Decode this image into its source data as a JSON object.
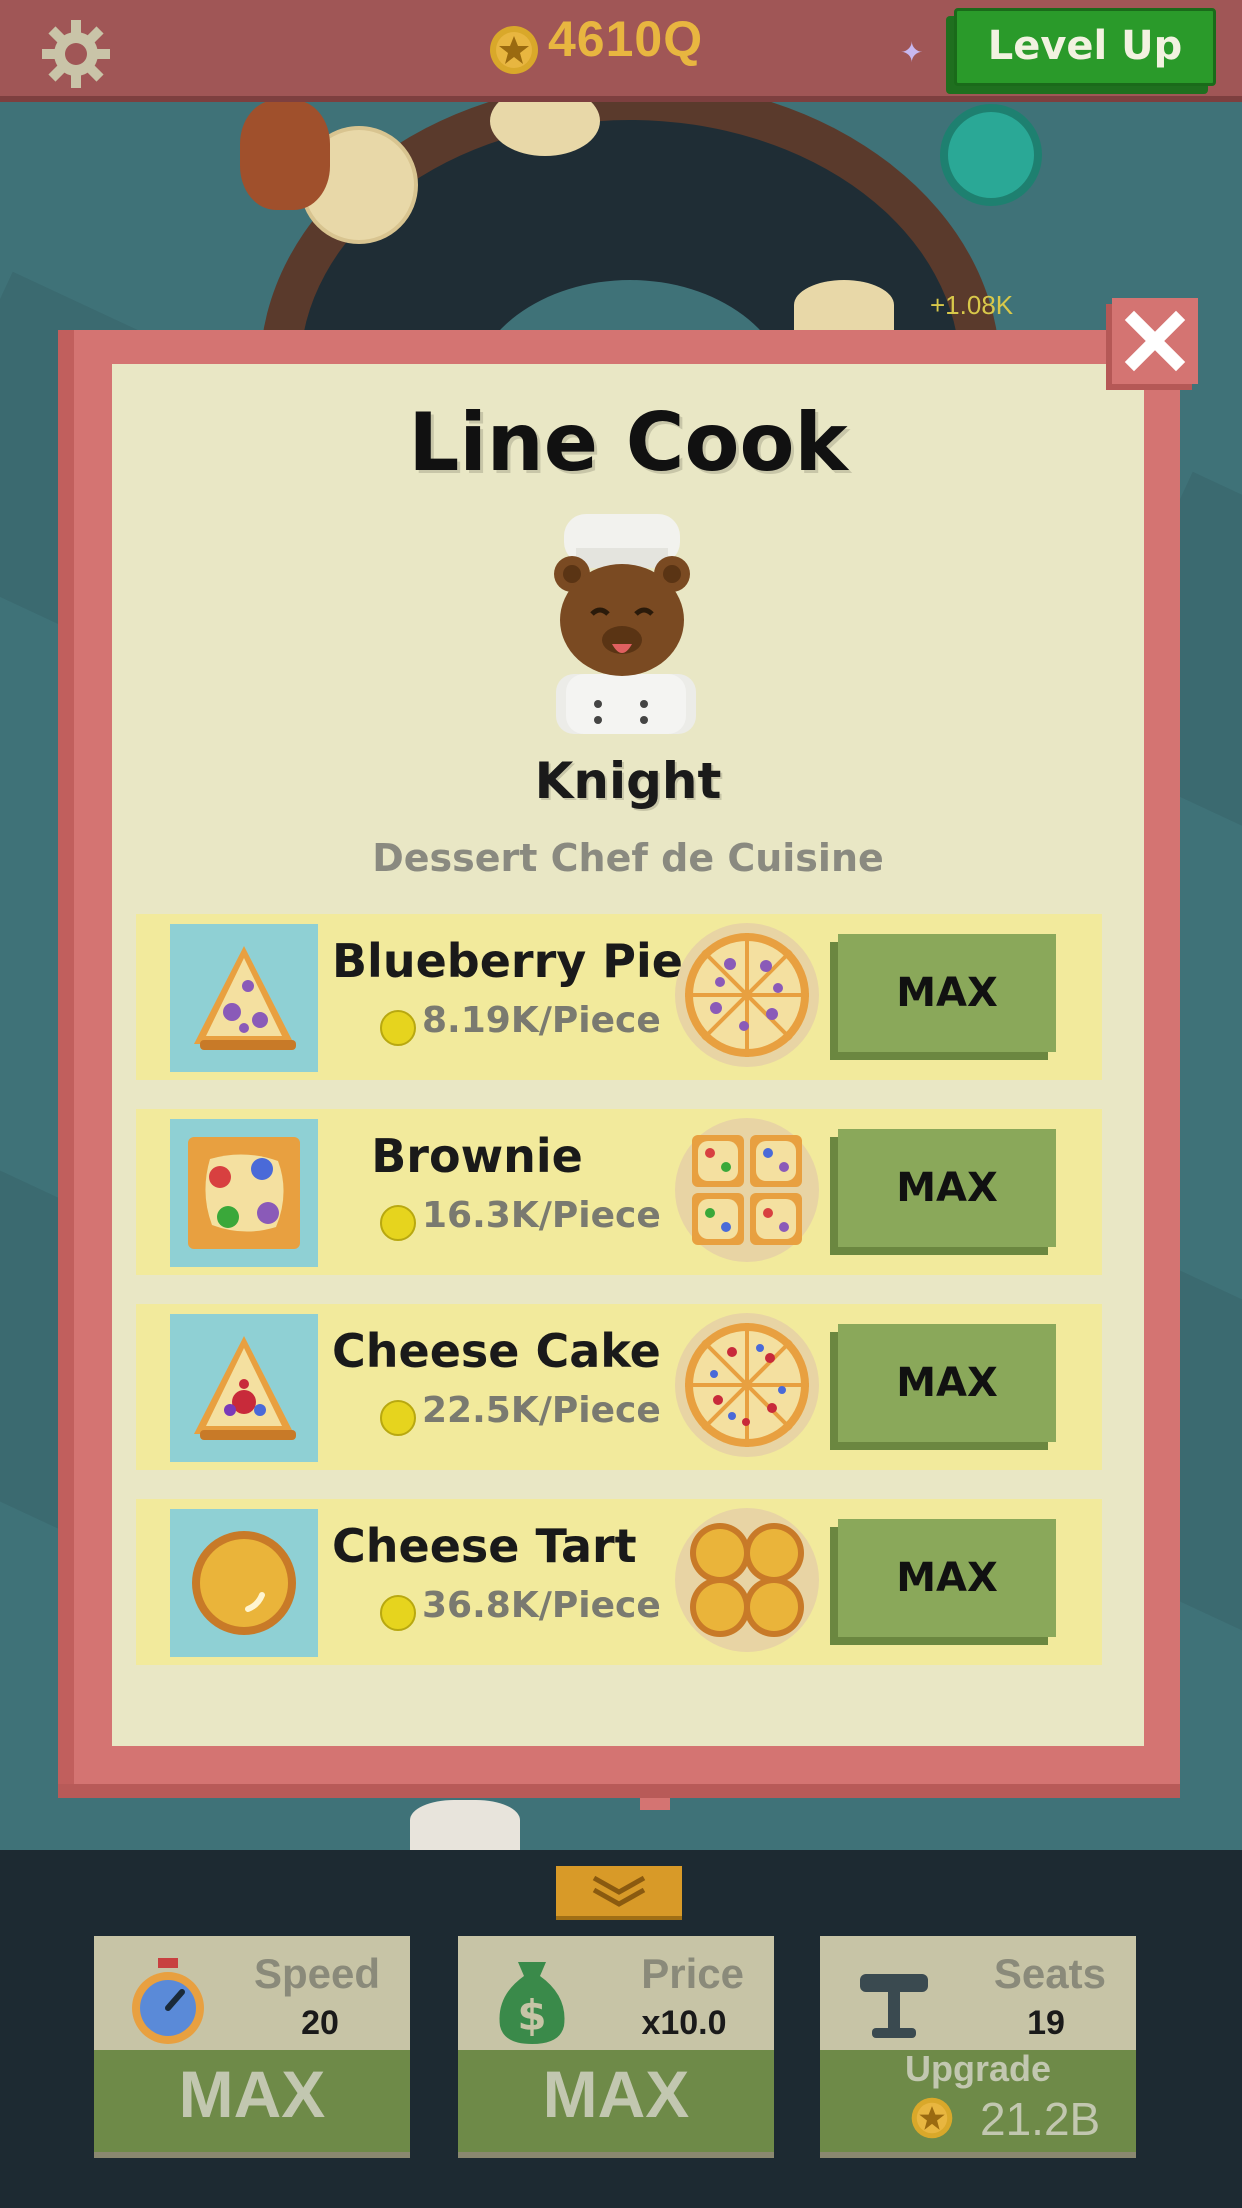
{
  "header": {
    "currency": "4610Q",
    "level_up_label": "Level Up",
    "floating_earning": "+1.08K"
  },
  "dialog": {
    "title": "Line Cook",
    "chef_name": "Knight",
    "chef_rank": "Dessert Chef de Cuisine",
    "items": [
      {
        "name": "Blueberry Pie",
        "rate": "8.19K/Piece",
        "button": "MAX",
        "icon": "blueberry-pie-slice"
      },
      {
        "name": "Brownie",
        "rate": "16.3K/Piece",
        "button": "MAX",
        "icon": "brownie-square"
      },
      {
        "name": "Cheese Cake",
        "rate": "22.5K/Piece",
        "button": "MAX",
        "icon": "cheese-cake-slice"
      },
      {
        "name": "Cheese Tart",
        "rate": "36.8K/Piece",
        "button": "MAX",
        "icon": "cheese-tart"
      }
    ]
  },
  "upgrades": {
    "speed": {
      "title": "Speed",
      "value": "20",
      "action": "MAX"
    },
    "price": {
      "title": "Price",
      "value": "x10.0",
      "action": "MAX"
    },
    "seats": {
      "title": "Seats",
      "value": "19",
      "action": "Upgrade",
      "cost": "21.2B"
    }
  },
  "colors": {
    "frame": "#d47472",
    "panel": "#e9e7c5",
    "row": "#f2ea9c",
    "button": "#8aa85a",
    "currency": "#e8b640",
    "level_up": "#2a9a2a"
  }
}
